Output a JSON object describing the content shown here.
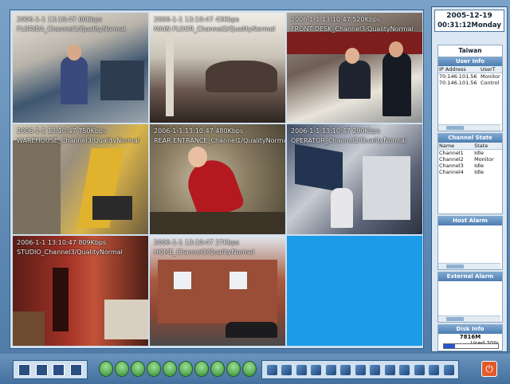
{
  "cameras": [
    {
      "line1": "2006-1-1 13:10:47   60Kbps",
      "line2": "FLORIDA_Channel1/QualityNormal"
    },
    {
      "line1": "2006-1-1 13:10:47   43Kbps",
      "line2": "MAIN FLOOR_Channel2/QualityNormal"
    },
    {
      "line1": "2006-1-1 13:10:47   520Kbps",
      "line2": "FRONT DESK_Channel3/QualityNormal"
    },
    {
      "line1": "2006-1-1 13:10:47   750Kbps",
      "line2": "WAREHOUSE_Channel3/QualityNormal"
    },
    {
      "line1": "2006-1-1 13:10:47   480Kbps",
      "line2": "REAR ENTRANCE_Channel1/QualityNormal"
    },
    {
      "line1": "2006-1-1 13:10:47   290Kbps",
      "line2": "OPERATOR_Channel2/QualityNormal"
    },
    {
      "line1": "2006-1-1 13:10:47   809Kbps",
      "line2": "STUDIO_Channel3/QualityNormal"
    },
    {
      "line1": "2006-1-1 13:10:47   27Kbps",
      "line2": "HOME_Channel3/QualityNormal"
    }
  ],
  "clock": {
    "date": "2005-12-19",
    "time": "00:31:12Monday"
  },
  "region": "Taiwan",
  "user_info": {
    "title": "User Info",
    "headers": [
      "IP Address",
      "UserT"
    ],
    "rows": [
      [
        "70.146.101.56",
        "Monitor"
      ],
      [
        "70.146.101.56",
        "Control"
      ]
    ]
  },
  "channel_state": {
    "title": "Channel State",
    "headers": [
      "Name",
      "State"
    ],
    "rows": [
      [
        "Channel1",
        "Idle"
      ],
      [
        "Channel2",
        "Monitor"
      ],
      [
        "Channel3",
        "Idle"
      ],
      [
        "Channel4",
        "Idle"
      ]
    ]
  },
  "host_alarm": {
    "title": "Host Alarm"
  },
  "external_alarm": {
    "title": "External Alarm"
  },
  "disk": {
    "title": "Disk Info",
    "size": "7816M",
    "used_label": "Used  20%",
    "used_fraction": 0.2
  },
  "colors": {
    "empty_tile": "#1b9be8",
    "panel_header": "#4d7db0",
    "power": "#e25a2a"
  }
}
